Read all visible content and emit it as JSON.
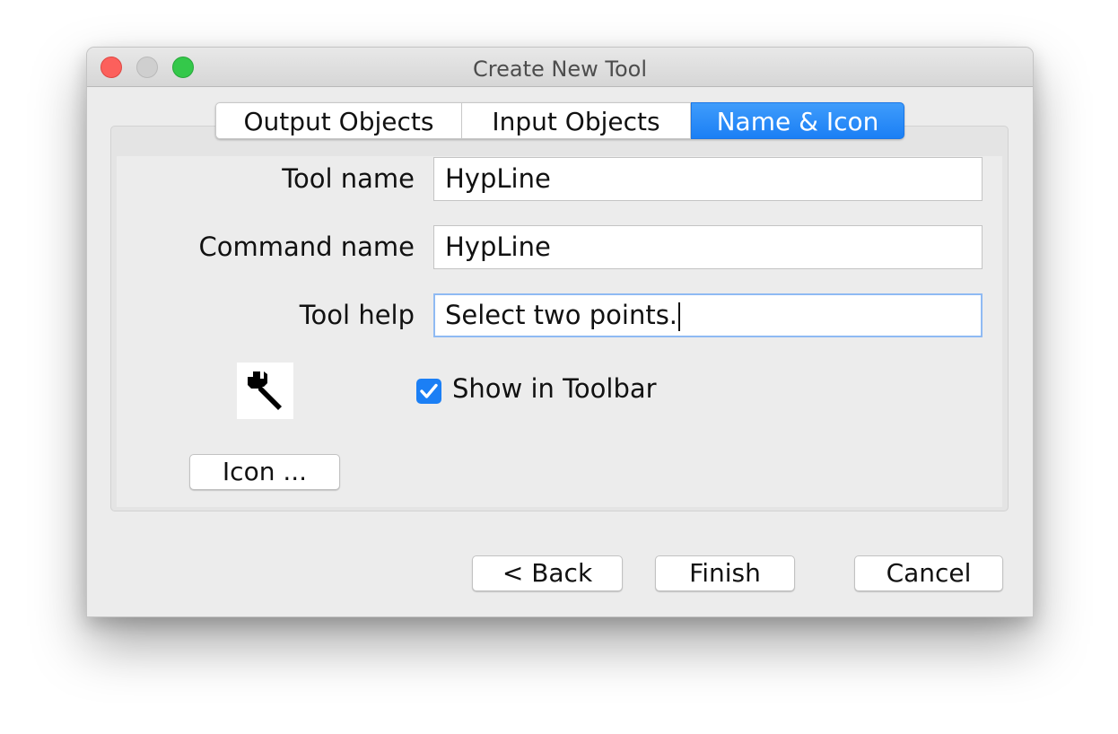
{
  "window": {
    "title": "Create New Tool"
  },
  "tabs": [
    {
      "label": "Output Objects",
      "active": false
    },
    {
      "label": "Input Objects",
      "active": false
    },
    {
      "label": "Name & Icon",
      "active": true
    }
  ],
  "form": {
    "tool_name_label": "Tool name",
    "tool_name_value": "HypLine",
    "command_name_label": "Command name",
    "command_name_value": "HypLine",
    "tool_help_label": "Tool help",
    "tool_help_value": "Select two points."
  },
  "icon": {
    "preview_icon": "wrench-icon",
    "button_label": "Icon ..."
  },
  "show_in_toolbar": {
    "label": "Show in Toolbar",
    "checked": true
  },
  "buttons": {
    "back_label": "< Back",
    "finish_label": "Finish",
    "cancel_label": "Cancel"
  },
  "colors": {
    "accent": "#1b7ff5",
    "close": "#fc605c",
    "minimize": "#cfcfcf",
    "maximize": "#34c84a"
  }
}
